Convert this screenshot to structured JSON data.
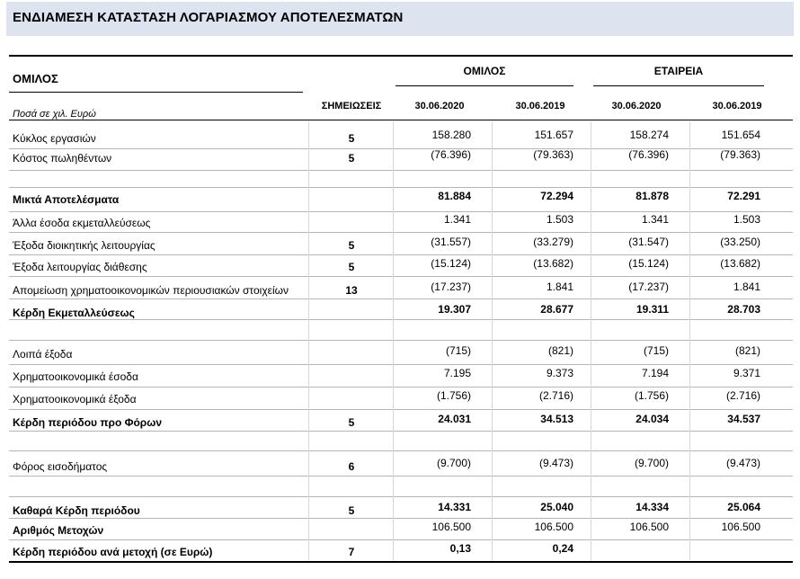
{
  "title": "ΕΝΔΙΑΜΕΣΗ ΚΑΤΑΣΤΑΣΗ ΛΟΓΑΡΙΑΣΜΟΥ ΑΠΟΤΕΛΕΣΜΑΤΩΝ",
  "header": {
    "group_label": "ΟΜΙΛΟΣ",
    "units_label": "Ποσά σε χιλ. Ευρώ",
    "notes_label": "ΣΗΜΕΙΩΣΕΙΣ",
    "group_col": "ΟΜΙΛΟΣ",
    "company_col": "ΕΤΑΙΡΕΙΑ",
    "dates": [
      "30.06.2020",
      "30.06.2019",
      "30.06.2020",
      "30.06.2019"
    ]
  },
  "rows": [
    {
      "label": "Κύκλος εργασιών",
      "note": "5",
      "values": [
        "158.280",
        "151.657",
        "158.274",
        "151.654"
      ],
      "bold": false
    },
    {
      "label": "Κόστος πωληθέντων",
      "note": "5",
      "values": [
        "(76.396)",
        "(79.363)",
        "(76.396)",
        "(79.363)"
      ],
      "bold": false
    },
    {
      "label": "Μικτά Αποτελέσματα",
      "note": "",
      "values": [
        "81.884",
        "72.294",
        "81.878",
        "72.291"
      ],
      "bold": true
    },
    {
      "label": "Άλλα έσοδα εκμεταλλεύσεως",
      "note": "",
      "values": [
        "1.341",
        "1.503",
        "1.341",
        "1.503"
      ],
      "bold": false
    },
    {
      "label": "Έξοδα διοικητικής λειτουργίας",
      "note": "5",
      "values": [
        "(31.557)",
        "(33.279)",
        "(31.547)",
        "(33.250)"
      ],
      "bold": false
    },
    {
      "label": "Έξοδα  λειτουργίας διάθεσης",
      "note": "5",
      "values": [
        "(15.124)",
        "(13.682)",
        "(15.124)",
        "(13.682)"
      ],
      "bold": false
    },
    {
      "label": "Απομείωση χρηματοοικονομικών περιουσιακών στοιχείων",
      "note": "13",
      "values": [
        "(17.237)",
        "1.841",
        "(17.237)",
        "1.841"
      ],
      "bold": false
    },
    {
      "label": "Κέρδη Εκμεταλλεύσεως",
      "note": "",
      "values": [
        "19.307",
        "28.677",
        "19.311",
        "28.703"
      ],
      "bold": true
    },
    {
      "label": "Λοιπά έξοδα",
      "note": "",
      "values": [
        "(715)",
        "(821)",
        "(715)",
        "(821)"
      ],
      "bold": false
    },
    {
      "label": "Χρηματοοικονομικά έσοδα",
      "note": "",
      "values": [
        "7.195",
        "9.373",
        "7.194",
        "9.371"
      ],
      "bold": false
    },
    {
      "label": "Χρηματοοικονομικά έξοδα",
      "note": "",
      "values": [
        "(1.756)",
        "(2.716)",
        "(1.756)",
        "(2.716)"
      ],
      "bold": false
    },
    {
      "label": "Κέρδη περιόδου προ Φόρων",
      "note": "5",
      "values": [
        "24.031",
        "34.513",
        "24.034",
        "34.537"
      ],
      "bold": true
    },
    {
      "label": "Φόρος εισοδήματος",
      "note": "6",
      "values": [
        "(9.700)",
        "(9.473)",
        "(9.700)",
        "(9.473)"
      ],
      "bold": false
    },
    {
      "label": "Καθαρά Κέρδη περιόδου",
      "note": "5",
      "values": [
        "14.331",
        "25.040",
        "14.334",
        "25.064"
      ],
      "bold": true
    },
    {
      "label": "Αριθμός Μετοχών",
      "note": "",
      "values": [
        "106.500",
        "106.500",
        "106.500",
        "106.500"
      ],
      "bold": true,
      "values_plain": true
    },
    {
      "label": "Κέρδη περιόδου ανά μετοχή (σε Ευρώ)",
      "note": "7",
      "values": [
        "0,13",
        "0,24",
        "",
        ""
      ],
      "bold": true
    }
  ]
}
